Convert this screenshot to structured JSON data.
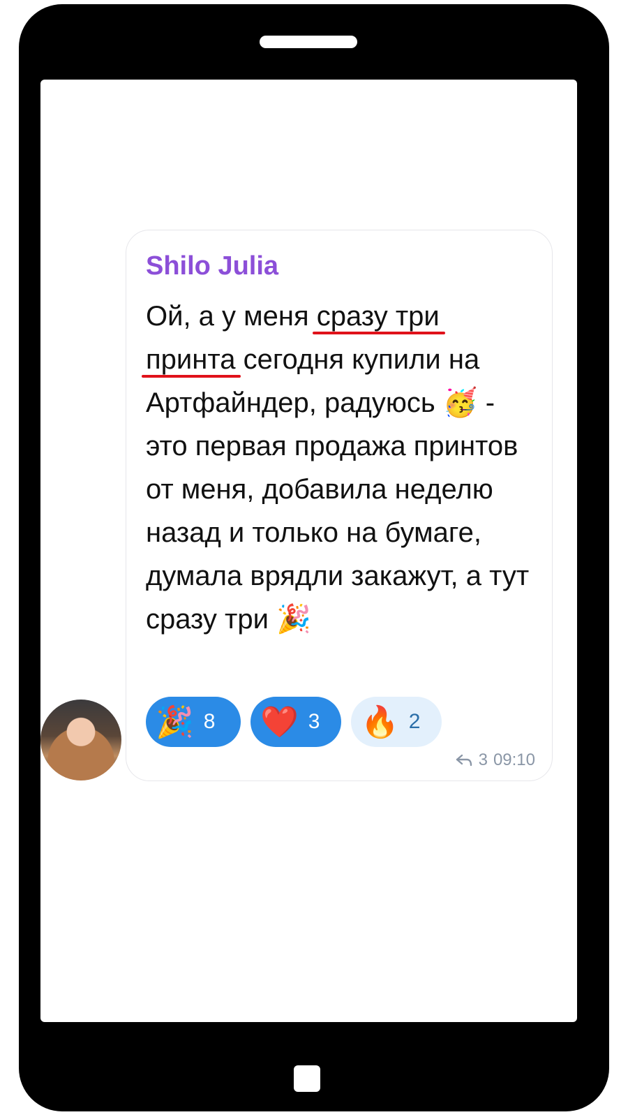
{
  "message": {
    "sender": "Shilo Julia",
    "lines": [
      {
        "pre": "Ой, а у меня ",
        "underlined": "сразу три",
        "post": ""
      },
      {
        "pre": "",
        "underlined": "принта",
        "post": " сегодня купили на"
      },
      {
        "pre": "Артфайндер, радуюсь ",
        "emoji": "🥳",
        "post": " -"
      },
      {
        "pre": "это первая продажа принтов"
      },
      {
        "pre": "от меня, добавила неделю"
      },
      {
        "pre": "назад и только на бумаге,"
      },
      {
        "pre": "думала врядли закажут, а тут"
      },
      {
        "pre": "сразу три ",
        "emoji": "🎉"
      }
    ],
    "reactions": [
      {
        "emoji": "🎉",
        "count": "8",
        "active": true
      },
      {
        "emoji": "❤️",
        "count": "3",
        "active": true
      },
      {
        "emoji": "🔥",
        "count": "2",
        "active": false
      }
    ],
    "reply_count": "3",
    "time": "09:10"
  },
  "icons": {
    "reply": "reply-arrow-icon",
    "avatar": "user-avatar"
  },
  "colors": {
    "sender": "#8c4fd8",
    "underline": "#e0121a",
    "reaction_active": "#2b8be6",
    "reaction_inactive": "#e3f0fc",
    "meta": "#8a96a6"
  }
}
